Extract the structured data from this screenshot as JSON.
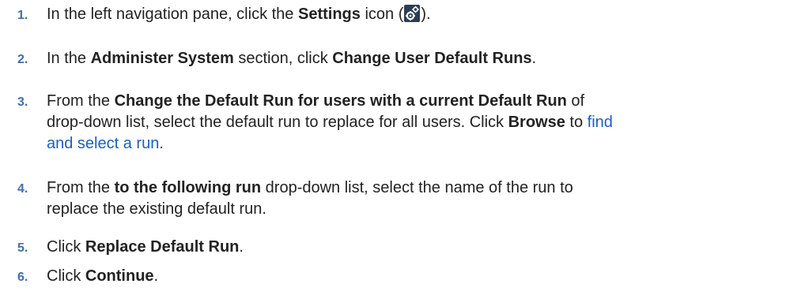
{
  "steps": [
    {
      "num": "1.",
      "parts": [
        "In the left navigation pane, click the ",
        "Settings",
        " icon (",
        ")."
      ],
      "icon": "settings-gears-icon"
    },
    {
      "num": "2.",
      "parts": [
        "In the ",
        "Administer System",
        " section, click ",
        "Change User Default Runs",
        "."
      ]
    },
    {
      "num": "3.",
      "line1": [
        "From the ",
        "Change the Default Run for users with a current Default Run",
        " of"
      ],
      "line2": [
        "drop-down list, select the default run to replace for all users. Click ",
        "Browse",
        " to ",
        "find"
      ],
      "line3": [
        "and select a run",
        "."
      ]
    },
    {
      "num": "4.",
      "line1": [
        "From the ",
        "to the following run",
        " drop-down list, select the name of the run to"
      ],
      "line2": [
        "replace the existing default run."
      ]
    },
    {
      "num": "5.",
      "parts": [
        "Click ",
        "Replace Default Run",
        "."
      ]
    },
    {
      "num": "6.",
      "parts": [
        "Click ",
        "Continue",
        "."
      ]
    }
  ],
  "colors": {
    "number": "#3d6fb3",
    "link": "#1a5fc8",
    "text": "#222222",
    "icon_bg": "#2c3e55"
  }
}
